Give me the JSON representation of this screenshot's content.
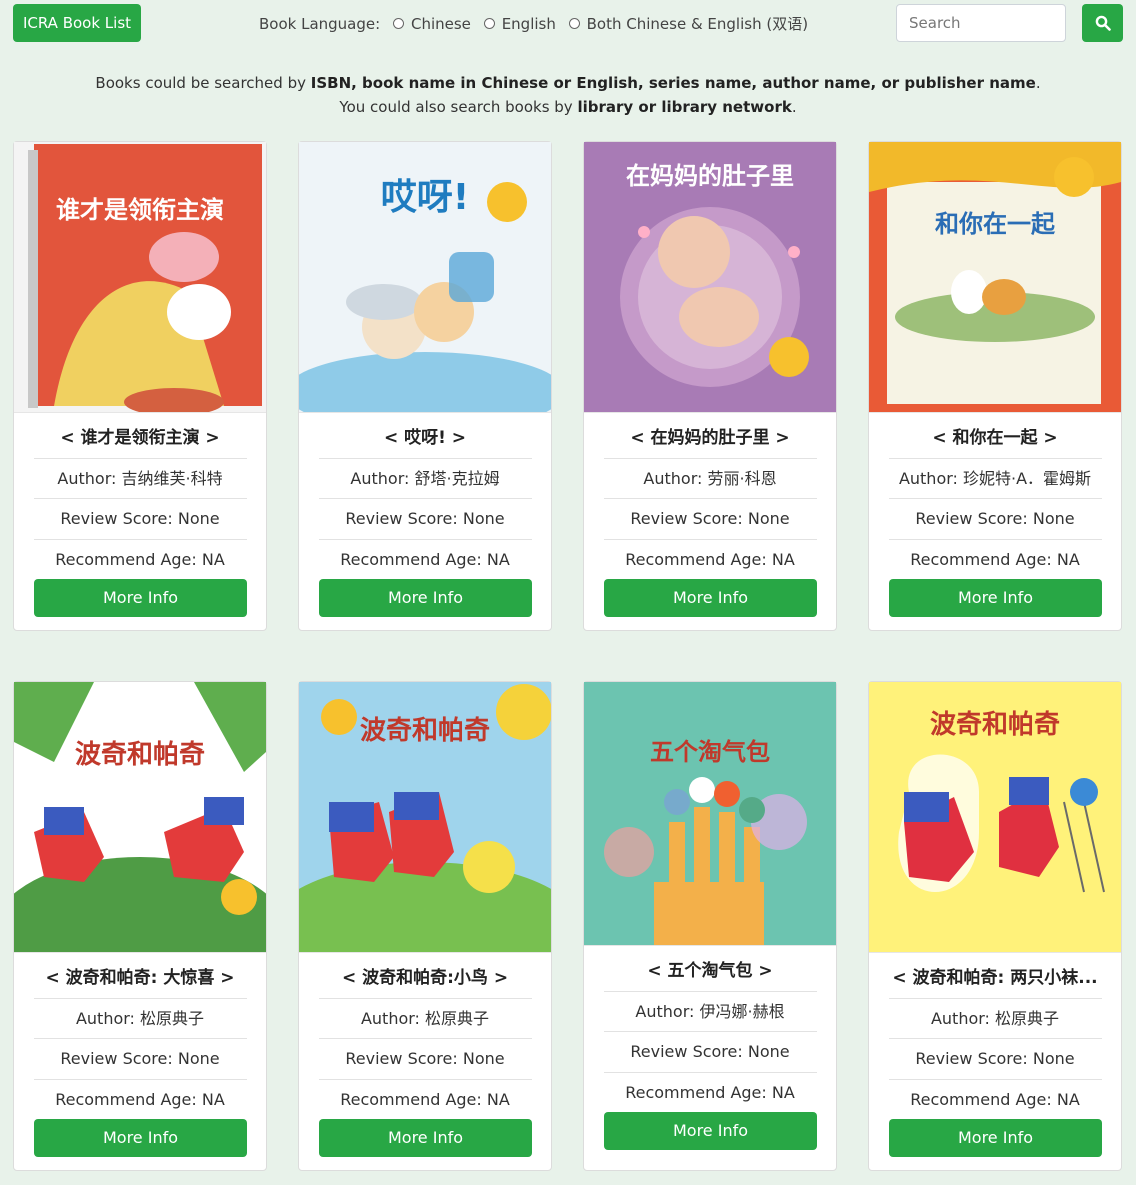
{
  "nav": {
    "brand": "ICRA Book List",
    "search_placeholder": "Search"
  },
  "language_filter": {
    "label": "Book Language:",
    "options": [
      "Chinese",
      "English",
      "Both Chinese & English (双语)"
    ]
  },
  "info": {
    "line1_prefix": "Books could be searched by ",
    "line1_bold": "ISBN, book name in Chinese or English, series name, author name, or publisher name",
    "line1_suffix": ".",
    "line2_prefix": "You could also search books by ",
    "line2_bold": "library or library network",
    "line2_suffix": "."
  },
  "books": [
    {
      "title": "< 谁才是领衔主演 >",
      "author": "Author: 吉纳维芙·科特",
      "review": "Review Score: None",
      "age": "Recommend Age: NA",
      "button": "More Info",
      "cover_title": "谁才是领衔主演",
      "colors": {
        "bg": "#e2553c",
        "accent": "#f2a07a"
      }
    },
    {
      "title": "< 哎呀! >",
      "author": "Author: 舒塔·克拉姆",
      "review": "Review Score: None",
      "age": "Recommend Age: NA",
      "button": "More Info",
      "cover_title": "哎呀!",
      "colors": {
        "bg": "#eef4f8",
        "accent": "#5aa8d8"
      }
    },
    {
      "title": "< 在妈妈的肚子里 >",
      "author": "Author: 劳丽·科恩",
      "review": "Review Score: None",
      "age": "Recommend Age: NA",
      "button": "More Info",
      "cover_title": "在妈妈的肚子里",
      "colors": {
        "bg": "#a87bb5",
        "accent": "#f0c8b0"
      }
    },
    {
      "title": "< 和你在一起 >",
      "author": "Author: 珍妮特·A．霍姆斯",
      "review": "Review Score: None",
      "age": "Recommend Age: NA",
      "button": "More Info",
      "cover_title": "和你在一起",
      "colors": {
        "bg": "#e95a36",
        "accent": "#f6f3e4"
      }
    },
    {
      "title": "< 波奇和帕奇: 大惊喜 >",
      "author": "Author: 松原典子",
      "review": "Review Score: None",
      "age": "Recommend Age: NA",
      "button": "More Info",
      "cover_title": "波奇和帕奇",
      "colors": {
        "bg": "#ffffff",
        "accent": "#5fae4e"
      }
    },
    {
      "title": "< 波奇和帕奇:小鸟 >",
      "author": "Author: 松原典子",
      "review": "Review Score: None",
      "age": "Recommend Age: NA",
      "button": "More Info",
      "cover_title": "波奇和帕奇",
      "colors": {
        "bg": "#9fd4ec",
        "accent": "#78c050"
      }
    },
    {
      "title": "< 五个淘气包 >",
      "author": "Author: 伊冯娜·赫根",
      "review": "Review Score: None",
      "age": "Recommend Age: NA",
      "button": "More Info",
      "cover_title": "五个淘气包",
      "colors": {
        "bg": "#6cc4b0",
        "accent": "#f3b04a"
      }
    },
    {
      "title": "< 波奇和帕奇: 两只小袜...",
      "author": "Author: 松原典子",
      "review": "Review Score: None",
      "age": "Recommend Age: NA",
      "button": "More Info",
      "cover_title": "波奇和帕奇",
      "colors": {
        "bg": "#fff27a",
        "accent": "#e03040"
      }
    }
  ]
}
